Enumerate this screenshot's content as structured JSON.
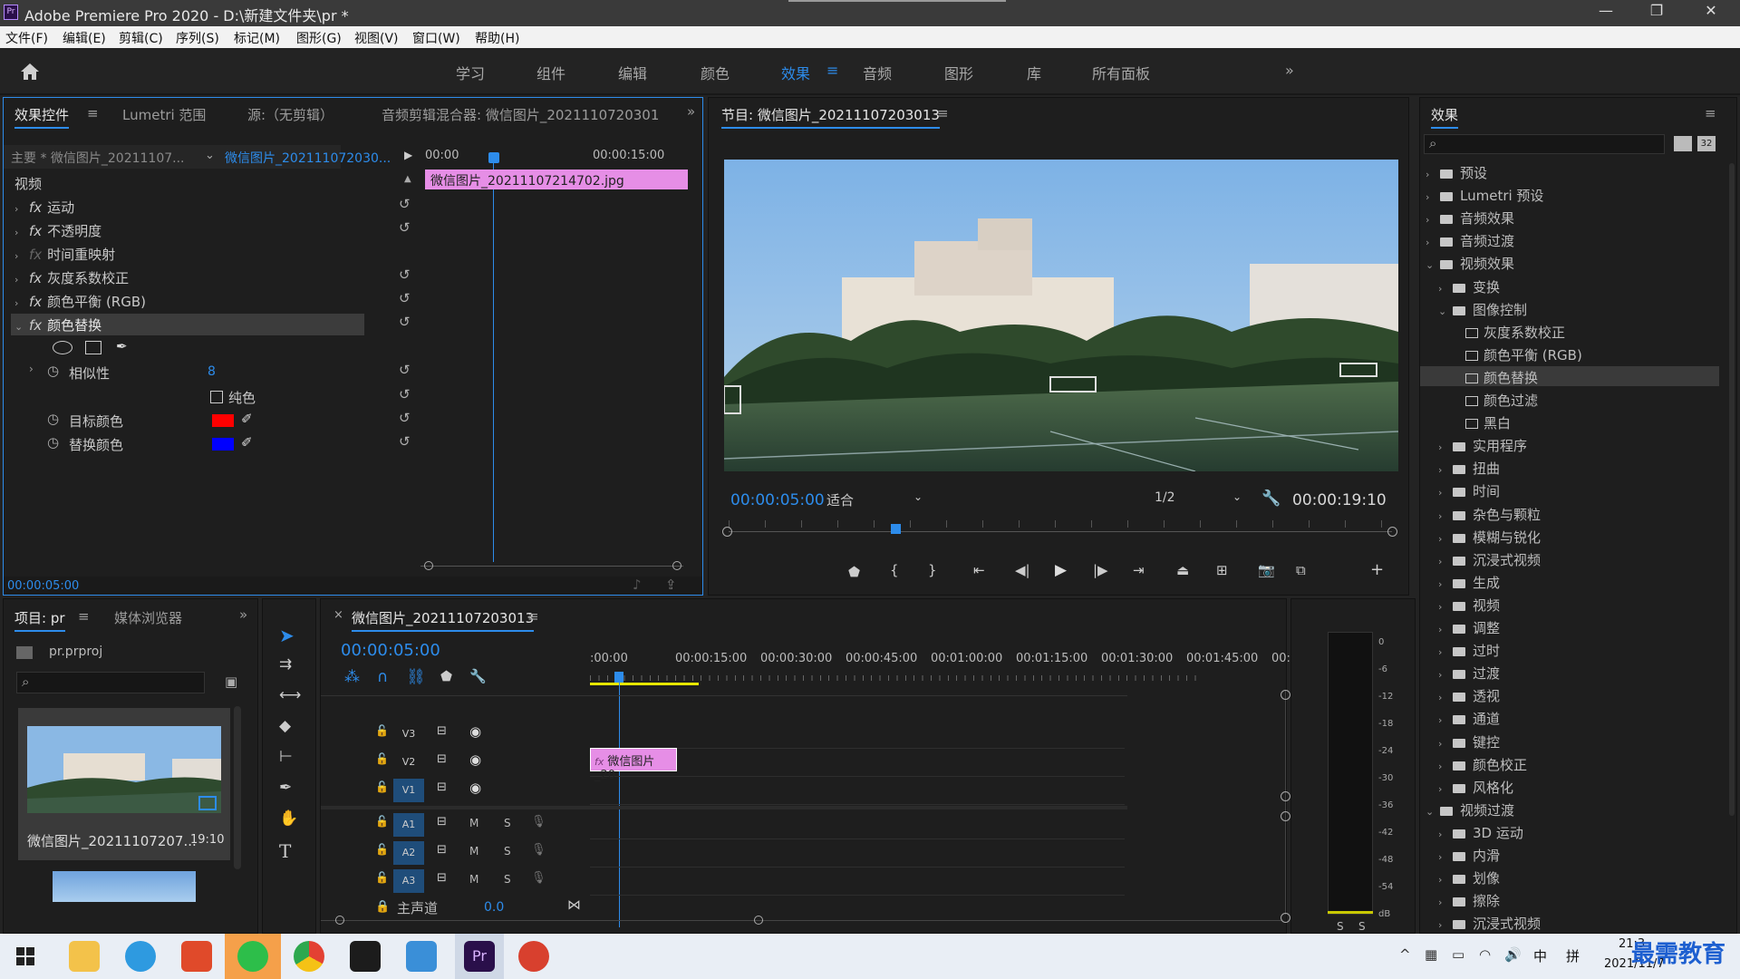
{
  "window": {
    "title": "Adobe Premiere Pro 2020 - D:\\新建文件夹\\pr *",
    "min": "—",
    "restore": "❐",
    "close": "✕"
  },
  "menu": [
    "文件(F)",
    "编辑(E)",
    "剪辑(C)",
    "序列(S)",
    "标记(M)",
    "图形(G)",
    "视图(V)",
    "窗口(W)",
    "帮助(H)"
  ],
  "workspaces": [
    "学习",
    "组件",
    "编辑",
    "颜色",
    "效果",
    "音频",
    "图形",
    "库",
    "所有面板"
  ],
  "effect_controls": {
    "tabs": [
      "效果控件",
      "Lumetri 范围",
      "源:（无剪辑）",
      "音频剪辑混合器: 微信图片_2021110720301"
    ],
    "master": "主要 * 微信图片_20211107...",
    "clip_name": "微信图片_202111072030...",
    "ruler": [
      "00:00",
      "00:00:15:00"
    ],
    "clip_bar": "微信图片_20211107214702.jpg",
    "section": "视频",
    "effects": [
      "运动",
      "不透明度",
      "时间重映射",
      "灰度系数校正",
      "颜色平衡 (RGB)",
      "颜色替换"
    ],
    "similarity_label": "相似性",
    "similarity_value": "8",
    "solid_label": "纯色",
    "target_label": "目标颜色",
    "replace_label": "替换颜色",
    "timecode": "00:00:05:00",
    "target_color": "#ff0000",
    "replace_color": "#0000ff"
  },
  "program": {
    "title": "节目: 微信图片_20211107203013",
    "timecode": "00:00:05:00",
    "fit": "适合",
    "resolution": "1/2",
    "duration": "00:00:19:10"
  },
  "project": {
    "tabs": [
      "项目: pr",
      "媒体浏览器"
    ],
    "file": "pr.prproj",
    "item_name": "微信图片_20211107207...",
    "item_duration": "19:10"
  },
  "timeline": {
    "title": "微信图片_20211107203013",
    "timecode": "00:00:05:00",
    "ruler": [
      ":00:00",
      "00:00:15:00",
      "00:00:30:00",
      "00:00:45:00",
      "00:01:00:00",
      "00:01:15:00",
      "00:01:30:00",
      "00:01:45:00",
      "00:02:0"
    ],
    "video_tracks": [
      "V3",
      "V2",
      "V1"
    ],
    "audio_tracks": [
      "A1",
      "A2",
      "A3"
    ],
    "master": "主声道",
    "master_value": "0.0",
    "clip": "微信图片_20",
    "m": "M",
    "s": "S"
  },
  "meter": {
    "scale": [
      "0",
      "-6",
      "-12",
      "-18",
      "-24",
      "-30",
      "-36",
      "-42",
      "-48",
      "-54",
      "dB"
    ],
    "s": "S"
  },
  "effects_panel": {
    "title": "效果",
    "items": [
      {
        "label": "预设",
        "level": 0,
        "open": false,
        "type": "preset"
      },
      {
        "label": "Lumetri 预设",
        "level": 0,
        "open": false,
        "type": "preset"
      },
      {
        "label": "音频效果",
        "level": 0,
        "open": false,
        "type": "folder"
      },
      {
        "label": "音频过渡",
        "level": 0,
        "open": false,
        "type": "folder"
      },
      {
        "label": "视频效果",
        "level": 0,
        "open": true,
        "type": "folder"
      },
      {
        "label": "变换",
        "level": 1,
        "open": false,
        "type": "folder"
      },
      {
        "label": "图像控制",
        "level": 1,
        "open": true,
        "type": "folder"
      },
      {
        "label": "灰度系数校正",
        "level": 2,
        "type": "fx"
      },
      {
        "label": "颜色平衡 (RGB)",
        "level": 2,
        "type": "fx"
      },
      {
        "label": "颜色替换",
        "level": 2,
        "type": "fx",
        "selected": true
      },
      {
        "label": "颜色过滤",
        "level": 2,
        "type": "fx"
      },
      {
        "label": "黑白",
        "level": 2,
        "type": "fx"
      },
      {
        "label": "实用程序",
        "level": 1,
        "open": false,
        "type": "folder"
      },
      {
        "label": "扭曲",
        "level": 1,
        "open": false,
        "type": "folder"
      },
      {
        "label": "时间",
        "level": 1,
        "open": false,
        "type": "folder"
      },
      {
        "label": "杂色与颗粒",
        "level": 1,
        "open": false,
        "type": "folder"
      },
      {
        "label": "模糊与锐化",
        "level": 1,
        "open": false,
        "type": "folder"
      },
      {
        "label": "沉浸式视频",
        "level": 1,
        "open": false,
        "type": "folder"
      },
      {
        "label": "生成",
        "level": 1,
        "open": false,
        "type": "folder"
      },
      {
        "label": "视频",
        "level": 1,
        "open": false,
        "type": "folder"
      },
      {
        "label": "调整",
        "level": 1,
        "open": false,
        "type": "folder"
      },
      {
        "label": "过时",
        "level": 1,
        "open": false,
        "type": "folder"
      },
      {
        "label": "过渡",
        "level": 1,
        "open": false,
        "type": "folder"
      },
      {
        "label": "透视",
        "level": 1,
        "open": false,
        "type": "folder"
      },
      {
        "label": "通道",
        "level": 1,
        "open": false,
        "type": "folder"
      },
      {
        "label": "键控",
        "level": 1,
        "open": false,
        "type": "folder"
      },
      {
        "label": "颜色校正",
        "level": 1,
        "open": false,
        "type": "folder"
      },
      {
        "label": "风格化",
        "level": 1,
        "open": false,
        "type": "folder"
      },
      {
        "label": "视频过渡",
        "level": 0,
        "open": true,
        "type": "folder"
      },
      {
        "label": "3D 运动",
        "level": 1,
        "open": false,
        "type": "folder"
      },
      {
        "label": "内滑",
        "level": 1,
        "open": false,
        "type": "folder"
      },
      {
        "label": "划像",
        "level": 1,
        "open": false,
        "type": "folder"
      },
      {
        "label": "擦除",
        "level": 1,
        "open": false,
        "type": "folder"
      },
      {
        "label": "沉浸式视频",
        "level": 1,
        "open": false,
        "type": "folder"
      }
    ]
  },
  "taskbar": {
    "ime": "中",
    "ime2": "拼",
    "time": "21:3",
    "date": "2021/11/7",
    "watermark": "最需教育"
  }
}
